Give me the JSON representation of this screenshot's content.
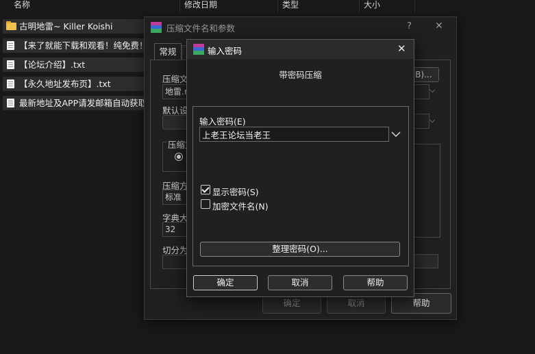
{
  "explorer": {
    "columns": [
      "名称",
      "修改日期",
      "类型",
      "大小"
    ],
    "files": [
      {
        "icon": "folder-icon",
        "name": "古明地雷~ Killer Koishi"
      },
      {
        "icon": "text-file-icon",
        "name": "【来了就能下载和观看！纯免费！"
      },
      {
        "icon": "text-file-icon",
        "name": "【论坛介绍】.txt"
      },
      {
        "icon": "text-file-icon",
        "name": "【永久地址发布页】.txt"
      },
      {
        "icon": "text-file-icon",
        "name": "最新地址及APP请发邮箱自动获取！"
      }
    ]
  },
  "back_dialog": {
    "title": "压缩文件名和参数",
    "help_glyph": "?",
    "close_glyph": "✕",
    "tabs": [
      "常规",
      ""
    ],
    "archive_name_label": "压缩文",
    "archive_name_value": "地雷.r",
    "browse_label": "(B)...",
    "default_settings_label": "默认设",
    "archive_format_label": "压缩文",
    "method_label": "压缩方",
    "method_value": "标准",
    "dict_label": "字典大",
    "dict_value": "32",
    "split_label": "切分为",
    "buttons": {
      "ok": "确定",
      "cancel": "取消",
      "help": "帮助"
    }
  },
  "front_dialog": {
    "title": "输入密码",
    "close_glyph": "✕",
    "heading": "带密码压缩",
    "password_label": "输入密码(E)",
    "password_value": "上老王论坛当老王",
    "show_password_label": "显示密码(S)",
    "show_password_checked": true,
    "encrypt_names_label": "加密文件名(N)",
    "encrypt_names_checked": false,
    "organize_button": "整理密码(O)...",
    "buttons": {
      "ok": "确定",
      "cancel": "取消",
      "help": "帮助"
    }
  },
  "colors": {
    "background": "#191919",
    "dialog": "#202020",
    "file_row": "#2d2d2d",
    "folder": "#f2c04c",
    "rar_stripes": [
      "#c03a9a",
      "#3a6ad0",
      "#3aa860"
    ]
  }
}
